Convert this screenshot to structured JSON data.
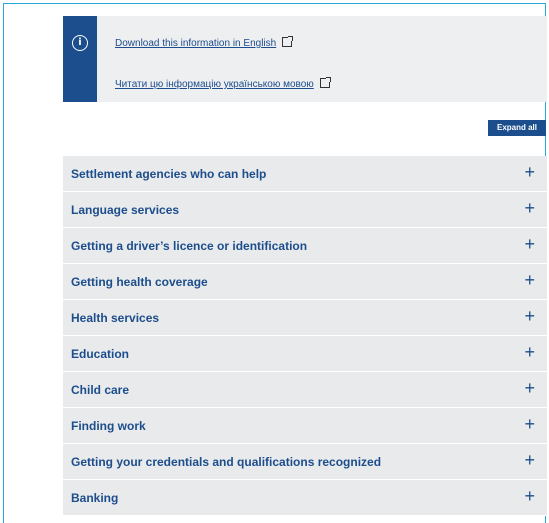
{
  "info": {
    "icon": "info-icon",
    "link_english": "Download this information in English",
    "link_ukrainian": "Читати цю інформацію українською мовою",
    "link_icon": "external-link-icon",
    "accent_color": "#1c4d8c"
  },
  "controls": {
    "expand_all_label": "Expand all"
  },
  "accordion": {
    "expand_icon": "plus-icon",
    "items": [
      {
        "label": "Settlement agencies who can help"
      },
      {
        "label": "Language services"
      },
      {
        "label": "Getting a driver’s licence or identification"
      },
      {
        "label": "Getting health coverage"
      },
      {
        "label": "Health services"
      },
      {
        "label": "Education"
      },
      {
        "label": "Child care"
      },
      {
        "label": "Finding work"
      },
      {
        "label": "Getting your credentials and qualifications recognized"
      },
      {
        "label": "Banking"
      }
    ]
  }
}
